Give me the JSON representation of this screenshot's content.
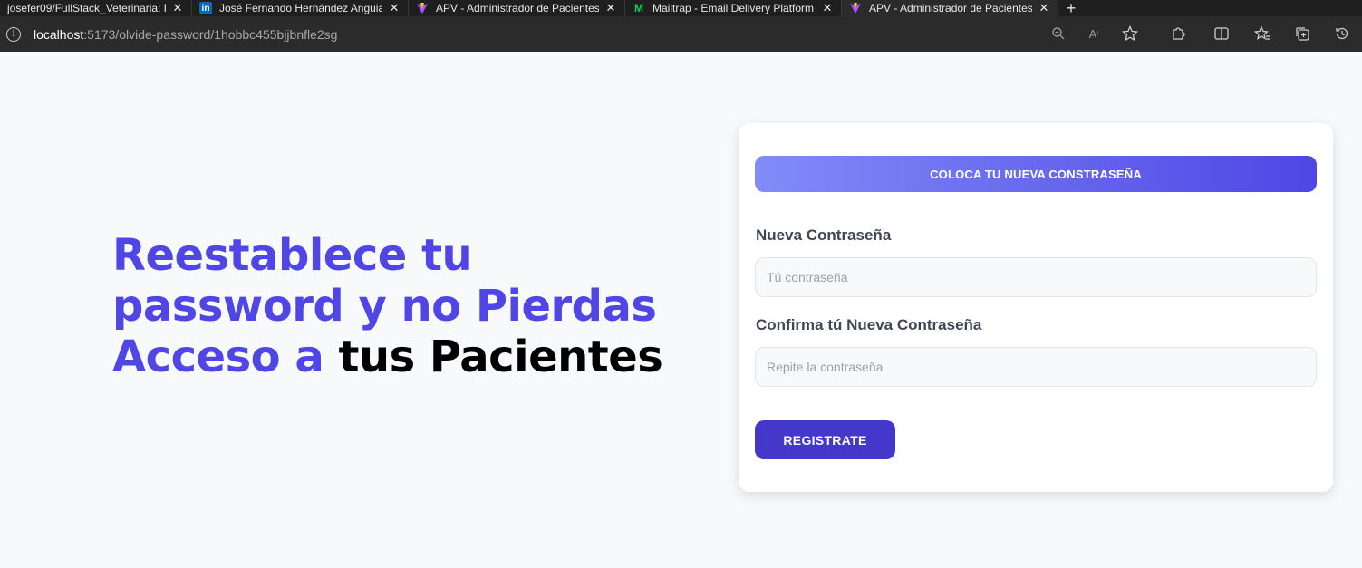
{
  "browser": {
    "tabs": [
      {
        "title": "josefer09/FullStack_Veterinaria: P",
        "icon": "github-icon"
      },
      {
        "title": "José Fernando Hernández Anguia",
        "icon": "linkedin-icon"
      },
      {
        "title": "APV - Administrador de Pacientes",
        "icon": "vite-icon"
      },
      {
        "title": "Mailtrap - Email Delivery Platform",
        "icon": "mailtrap-icon"
      },
      {
        "title": "APV - Administrador de Pacientes",
        "icon": "vite-icon"
      }
    ],
    "url": {
      "host": "localhost",
      "path": ":5173/olvide-password/1hobbc455bjjbnfle2sg"
    }
  },
  "hero": {
    "line1": "Reestablece tu",
    "line2": "password y no Pierdas",
    "line3_accent": "Acceso a",
    "line3_dark": "tus Pacientes"
  },
  "form": {
    "alert": "COLOCA TU NUEVA CONSTRASEÑA",
    "password_label": "Nueva Contraseña",
    "password_placeholder": "Tú contraseña",
    "confirm_label": "Confirma tú Nueva Contraseña",
    "confirm_placeholder": "Repite la contraseña",
    "submit_label": "REGISTRATE"
  },
  "colors": {
    "accent": "#4f46e5",
    "button": "#4338ca",
    "alert_from": "#818cf8",
    "alert_to": "#4f46e5"
  }
}
